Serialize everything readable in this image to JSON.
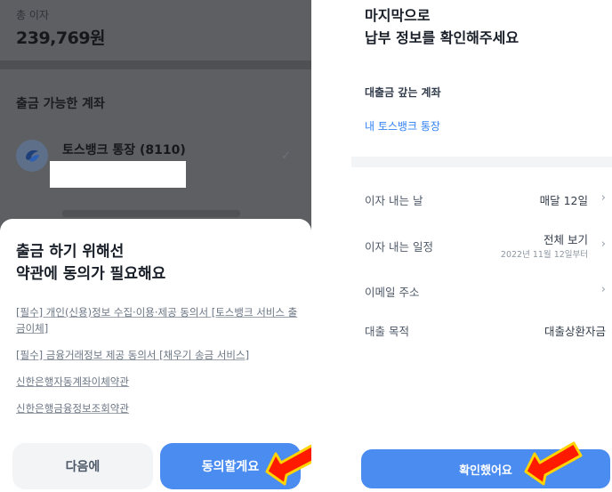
{
  "left": {
    "total_interest_label": "총 이자",
    "total_interest_value": "239,769원",
    "accounts_title": "출금 가능한 계좌",
    "account_name": "토스뱅크 통장 (8110)",
    "sheet": {
      "title_line1": "출금 하기 위해선",
      "title_line2": "약관에 동의가 필요해요",
      "terms": [
        "[필수] 개인(신용)정보 수집·이용·제공 동의서 [토스뱅크 서비스 출금이체]",
        "[필수] 금융거래정보 제공 동의서 [채우기 송금 서비스]",
        "신한은행자동계좌이체약관",
        "신한은행금융정보조회약관"
      ],
      "next_label": "다음에",
      "agree_label": "동의할게요"
    }
  },
  "right": {
    "title_line1": "마지막으로",
    "title_line2": "납부 정보를 확인해주세요",
    "repay_account_label": "대출금 갚는 계좌",
    "repay_account_value": "내 토스뱅크 통장",
    "rows": [
      {
        "label": "이자 내는 날",
        "value": "매달 12일"
      },
      {
        "label": "이자 내는 일정",
        "value": "전체 보기",
        "sub": "2022년 11월 12일부터"
      },
      {
        "label": "이메일 주소",
        "value": ""
      },
      {
        "label": "대출 목적",
        "value": "대출상환자금"
      }
    ],
    "confirm_label": "확인했어요"
  },
  "colors": {
    "primary": "#4a8cf0",
    "link": "#3182f6",
    "overlay": "#5d5f63",
    "arrow_fill": "#ff1a00",
    "arrow_outline": "#ffd400"
  }
}
